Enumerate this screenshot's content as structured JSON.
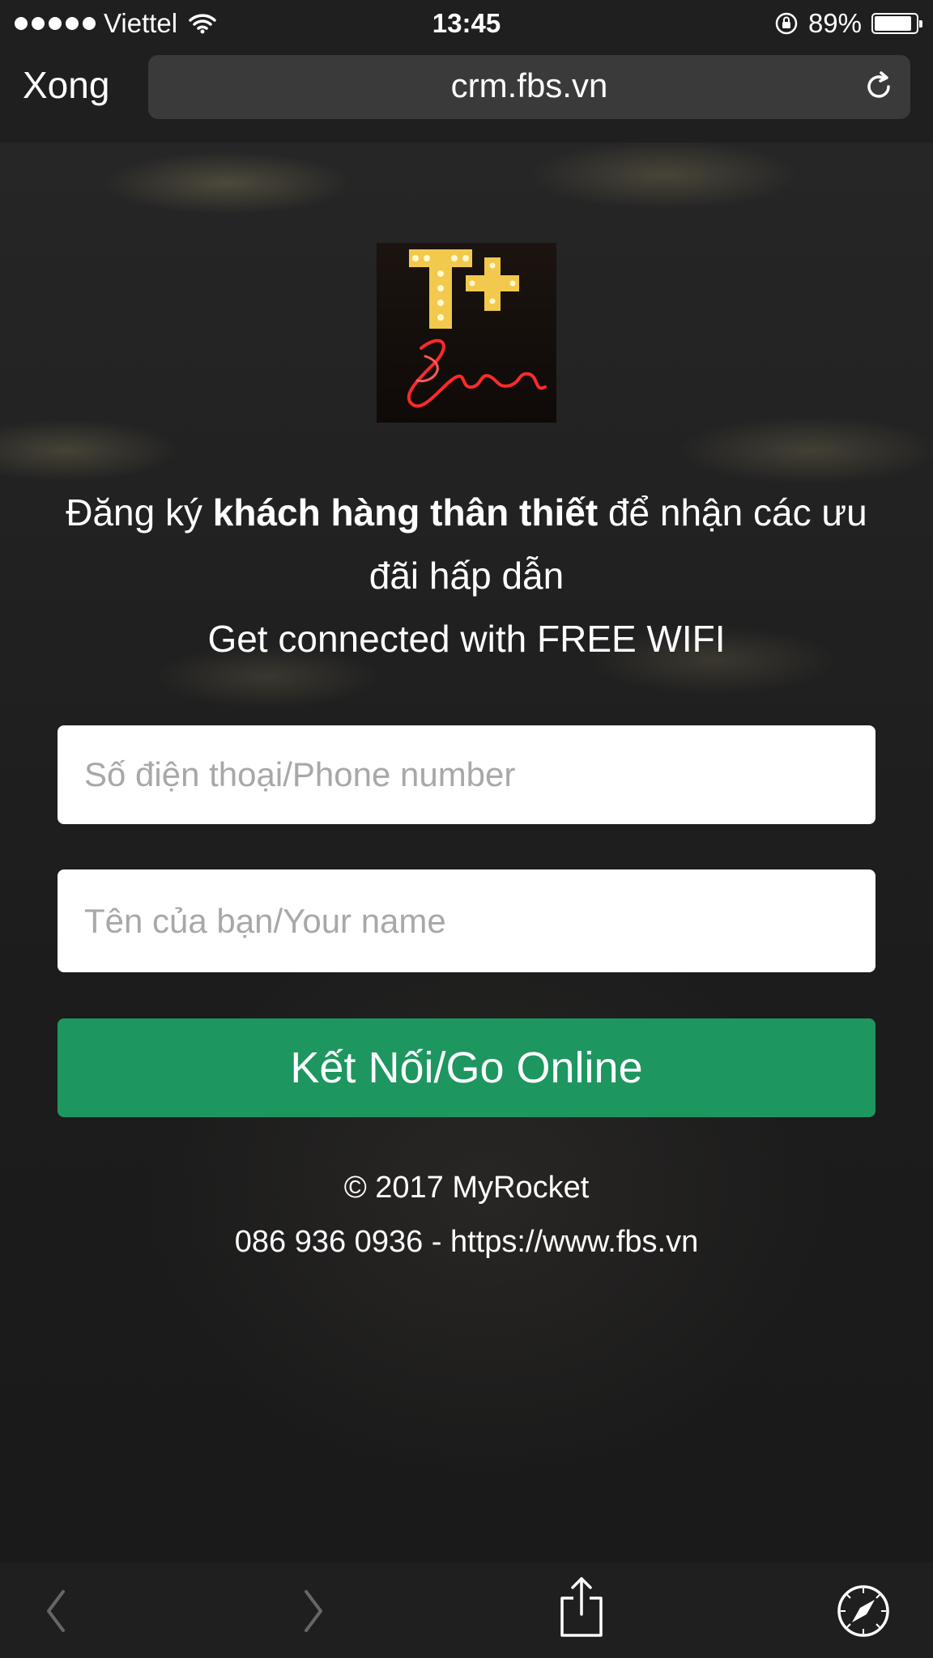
{
  "status_bar": {
    "carrier": "Viettel",
    "time": "13:45",
    "battery": "89%",
    "battery_level": 0.89
  },
  "browser": {
    "done_label": "Xong",
    "url": "crm.fbs.vn"
  },
  "page": {
    "headline_part1": "Đăng ký ",
    "headline_bold": "khách hàng thân thiết",
    "headline_part2": " để nhận các ưu đãi hấp dẫn",
    "headline_line2": "Get connected with FREE WIFI",
    "phone_placeholder": "Số điện thoại/Phone number",
    "name_placeholder": "Tên của bạn/Your name",
    "submit_label": "Kết Nối/Go Online",
    "copyright": "© 2017 MyRocket",
    "contact": "086 936 0936 - https://www.fbs.vn",
    "logo_text_top": "T+",
    "logo_text_script": "Beer"
  },
  "colors": {
    "button": "#1d9660",
    "logo_gold": "#f2c94c",
    "logo_neon": "#ff2a2a"
  }
}
